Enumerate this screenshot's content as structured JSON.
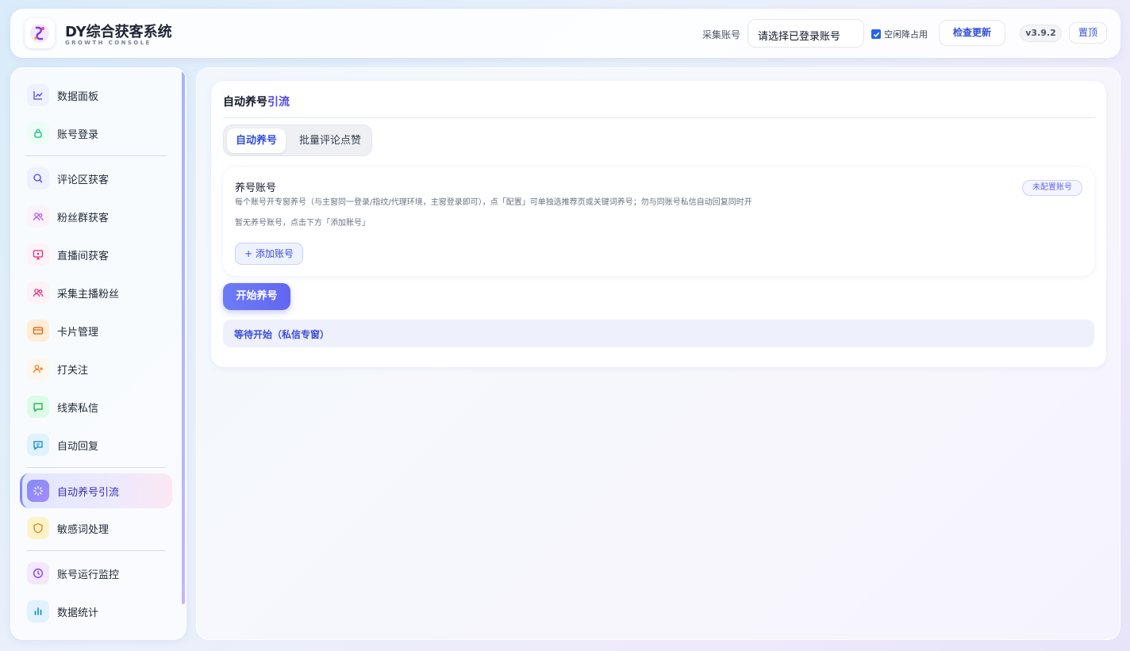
{
  "header": {
    "title": "DY综合获客系统",
    "subtitle": "GROWTH CONSOLE",
    "account_label": "采集账号",
    "account_select_value": "请选择已登录账号",
    "idle_release_label": "空闲降占用",
    "idle_release_checked": true,
    "check_update_label": "检查更新",
    "version": "v3.9.2",
    "top_label": "置顶"
  },
  "sidebar": {
    "items": [
      {
        "label": "数据面板",
        "icon": "line-chart-icon"
      },
      {
        "label": "账号登录",
        "icon": "lock-icon"
      },
      {
        "label": "评论区获客",
        "icon": "search-icon"
      },
      {
        "label": "粉丝群获客",
        "icon": "users-icon"
      },
      {
        "label": "直播间获客",
        "icon": "monitor-icon"
      },
      {
        "label": "采集主播粉丝",
        "icon": "users-icon"
      },
      {
        "label": "卡片管理",
        "icon": "card-icon"
      },
      {
        "label": "打关注",
        "icon": "user-plus-icon"
      },
      {
        "label": "线索私信",
        "icon": "chat-icon"
      },
      {
        "label": "自动回复",
        "icon": "reply-icon"
      },
      {
        "label": "自动养号引流",
        "icon": "spinner-icon",
        "active": true
      },
      {
        "label": "敏感词处理",
        "icon": "shield-icon"
      },
      {
        "label": "账号运行监控",
        "icon": "clock-icon"
      },
      {
        "label": "数据统计",
        "icon": "bar-chart-icon"
      }
    ]
  },
  "main": {
    "title_prefix": "自动养号",
    "title_accent": "引流",
    "tabs": [
      {
        "label": "自动养号",
        "active": true
      },
      {
        "label": "批量评论点赞",
        "active": false
      }
    ],
    "account_section": {
      "title": "养号账号",
      "description": "每个账号开专窗养号（与主窗同一登录/指纹/代理环境，主窗登录即可），点「配置」可单独选推荐页或关键词养号；勿与同账号私信自动回复同时开",
      "empty_text": "暂无养号账号，点击下方「添加账号」",
      "badge": "未配置账号",
      "add_button": "+ 添加账号"
    },
    "start_button": "开始养号",
    "status": "等待开始（私信专窗）"
  },
  "colors": {
    "accent": "#4f46e5",
    "primary_button": "#6366f1"
  }
}
